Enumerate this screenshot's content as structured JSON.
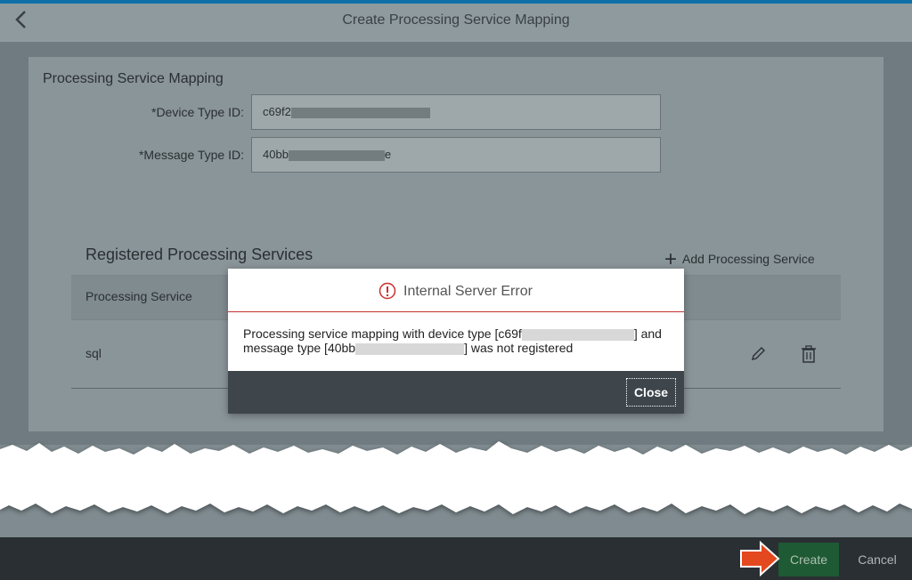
{
  "header": {
    "title": "Create Processing Service Mapping",
    "back_icon": "chevron-left-icon"
  },
  "form": {
    "section_title": "Processing Service Mapping",
    "device_type": {
      "required_mark": "*",
      "label": "Device Type ID:",
      "value_prefix": "c69f2",
      "value_suffix": ""
    },
    "message_type": {
      "required_mark": "*",
      "label": "Message Type ID:",
      "value_prefix": "40bb",
      "value_suffix": "e"
    }
  },
  "table": {
    "title": "Registered Processing Services",
    "add_label": "Add Processing Service",
    "add_icon": "plus-icon",
    "column_header": "Processing Service",
    "rows": [
      {
        "name": "sql"
      }
    ]
  },
  "dialog": {
    "title": "Internal Server Error",
    "icon": "error-icon",
    "message_line1_a": "Processing service mapping with device type [c69f",
    "message_line1_b": "] and",
    "message_line2_a": "message type [40bb",
    "message_line2_b": "] was not registered",
    "close_label": "Close"
  },
  "footer": {
    "create_label": "Create",
    "cancel_label": "Cancel"
  },
  "colors": {
    "accent": "#0f6fa8",
    "error": "#c9302c",
    "create_bg": "#1e5a33",
    "arrow": "#e4481f"
  }
}
